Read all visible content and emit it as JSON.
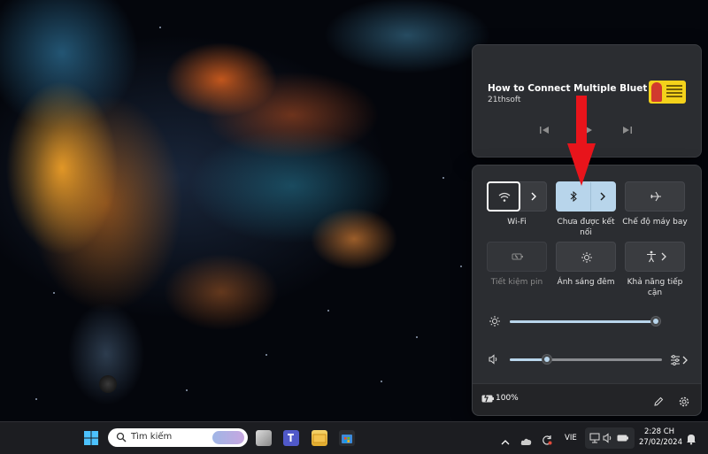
{
  "media": {
    "title": "How to Connect Multiple Bluetooth...",
    "source": "21thsoft",
    "controls": [
      "previous-track",
      "play-pause",
      "next-track"
    ]
  },
  "quick_settings": {
    "tiles": [
      {
        "id": "wifi",
        "label": "Wi-Fi",
        "icon": "wifi-icon",
        "state": "off",
        "has_expand": true
      },
      {
        "id": "bluetooth",
        "label": "Chưa được kết nối",
        "icon": "bluetooth-icon",
        "state": "on",
        "has_expand": true
      },
      {
        "id": "airplane",
        "label": "Chế độ máy bay",
        "icon": "airplane-icon",
        "state": "off",
        "has_expand": false
      },
      {
        "id": "battery-saver",
        "label": "Tiết kiệm pin",
        "icon": "battery-saver-icon",
        "state": "disabled",
        "has_expand": false
      },
      {
        "id": "night-light",
        "label": "Ánh sáng đêm",
        "icon": "night-light-icon",
        "state": "off",
        "has_expand": false
      },
      {
        "id": "accessibility",
        "label": "Khả năng tiếp cận",
        "icon": "accessibility-icon",
        "state": "off",
        "has_expand": true
      }
    ],
    "brightness": {
      "icon": "brightness-icon",
      "level": 1.0
    },
    "volume": {
      "icon": "speaker-icon",
      "level": 0.25
    },
    "battery": {
      "icon": "battery-charging-icon",
      "text": "100%"
    },
    "footer_icons": [
      "edit-icon",
      "settings-icon"
    ]
  },
  "taskbar": {
    "search_placeholder": "Tìm kiếm",
    "language": "VIE",
    "time": "2:28 CH",
    "date": "27/02/2024"
  },
  "colors": {
    "accent": "#b8d5eb",
    "panel": "#2b2d31",
    "taskbar": "#1c1d21",
    "annotation_arrow": "#e8141b"
  }
}
